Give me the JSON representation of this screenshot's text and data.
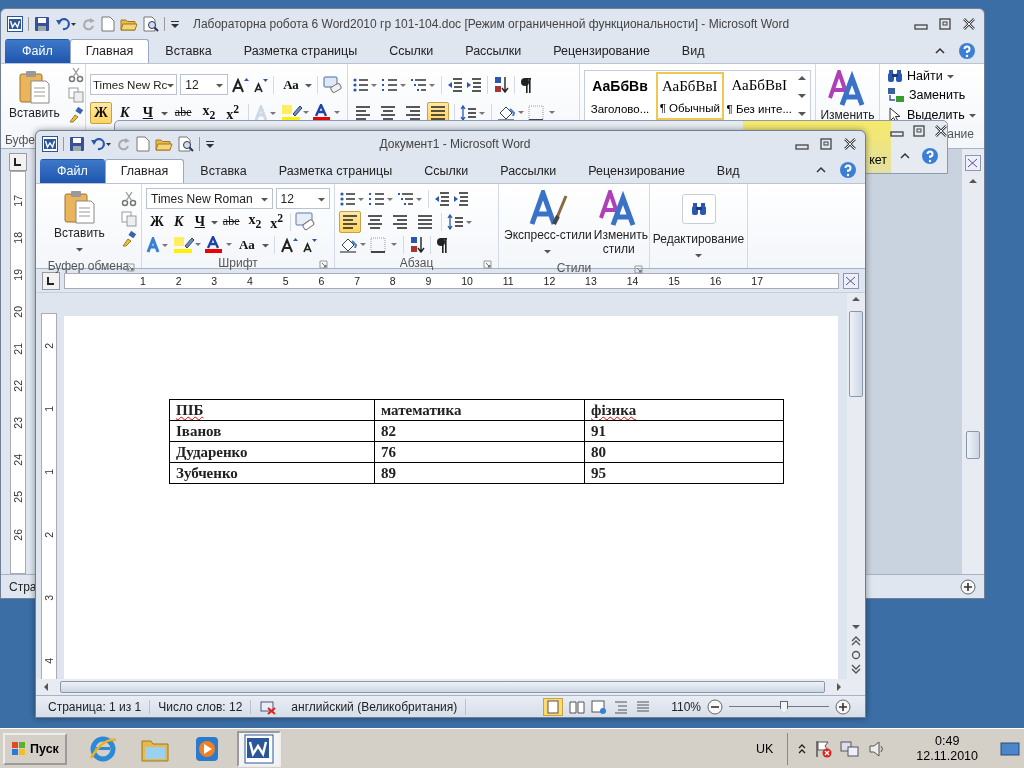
{
  "back_window": {
    "title": "Лабораторна робота 6 Word2010 гр 101-104.doc [Режим ограниченной функциональности]  -  Microsoft Word",
    "tabs": [
      {
        "label": "Файл",
        "kind": "file",
        "selected": false
      },
      {
        "label": "Главная",
        "kind": "tab",
        "selected": true
      },
      {
        "label": "Вставка",
        "kind": "tab",
        "selected": false
      },
      {
        "label": "Разметка страницы",
        "kind": "tab",
        "selected": false
      },
      {
        "label": "Ссылки",
        "kind": "tab",
        "selected": false
      },
      {
        "label": "Рассылки",
        "kind": "tab",
        "selected": false
      },
      {
        "label": "Рецензирование",
        "kind": "tab",
        "selected": false
      },
      {
        "label": "Вид",
        "kind": "tab",
        "selected": false
      }
    ],
    "paste_label": "Вставить",
    "font_name": "Times New Rc",
    "font_size": "12",
    "case_button": "Аа",
    "font_buttons": [
      {
        "label": "Ж",
        "selected": true
      },
      {
        "label": "К",
        "selected": false
      },
      {
        "label": "Ч",
        "selected": false
      },
      {
        "label": "abe",
        "selected": false
      },
      {
        "label": "x$_{2}$",
        "selected": false
      },
      {
        "label": "x$^{2}$",
        "selected": false
      }
    ],
    "align": [
      {
        "selected": false
      },
      {
        "selected": false
      },
      {
        "selected": false
      },
      {
        "selected": true
      }
    ],
    "styles": [
      {
        "sample": "АаБбВв",
        "name": "Заголово...",
        "selected": false
      },
      {
        "sample": "АаБбВвІ",
        "name": "¶ Обычный",
        "selected": true
      },
      {
        "sample": "АаБбВвІ",
        "name": "¶ Без инте...",
        "selected": false
      }
    ],
    "change_styles": "Изменить",
    "editing": [
      {
        "label": "Найти",
        "kind": "find"
      },
      {
        "label": "Заменить",
        "kind": "replace"
      },
      {
        "label": "Выделить",
        "kind": "select"
      }
    ],
    "group_labels": [
      "Буфе",
      "ание"
    ],
    "ruler_numbers": [
      "17",
      "18",
      "19",
      "20",
      "21",
      "22",
      "23",
      "24",
      "25",
      "26"
    ],
    "status": "Стра"
  },
  "third_window": {
    "text": "кет"
  },
  "front_window": {
    "title": "Документ1  -  Microsoft Word",
    "tabs": [
      {
        "label": "Файл",
        "kind": "file",
        "selected": false
      },
      {
        "label": "Главная",
        "kind": "tab",
        "selected": true
      },
      {
        "label": "Вставка",
        "kind": "tab",
        "selected": false
      },
      {
        "label": "Разметка страницы",
        "kind": "tab",
        "selected": false
      },
      {
        "label": "Ссылки",
        "kind": "tab",
        "selected": false
      },
      {
        "label": "Рассылки",
        "kind": "tab",
        "selected": false
      },
      {
        "label": "Рецензирование",
        "kind": "tab",
        "selected": false
      },
      {
        "label": "Вид",
        "kind": "tab",
        "selected": false
      }
    ],
    "paste_label": "Вставить",
    "font_name": "Times New Roman",
    "font_size": "12",
    "case_button": "Аа",
    "font_buttons": [
      {
        "label": "Ж",
        "selected": false
      },
      {
        "label": "К",
        "selected": false
      },
      {
        "label": "Ч",
        "selected": false
      },
      {
        "label": "abe",
        "selected": false
      },
      {
        "label": "x$_{2}$",
        "selected": false
      },
      {
        "label": "x$^{2}$",
        "selected": false
      }
    ],
    "align": [
      {
        "selected": true
      },
      {
        "selected": false
      },
      {
        "selected": false
      },
      {
        "selected": false
      }
    ],
    "quick_styles": "Экспресс-стили",
    "change_styles": "Изменить стили",
    "editing": "Редактирование",
    "group_labels": [
      "Буфер обмена",
      "Шрифт",
      "Абзац",
      "Стили"
    ],
    "ruler_numbers": [
      "1",
      "2",
      "3",
      "4",
      "5",
      "6",
      "7",
      "8",
      "9",
      "10",
      "11",
      "12",
      "13",
      "14",
      "15",
      "16",
      "17"
    ],
    "vruler_numbers": [
      "2",
      "1",
      "1",
      "2",
      "3",
      "4"
    ],
    "table": {
      "columns": [
        {
          "label": "ПІБ",
          "misspelled": true
        },
        {
          "label": "математика",
          "misspelled": false
        },
        {
          "label": "фізика",
          "misspelled": true
        }
      ],
      "rows": [
        [
          "Іванов",
          "82",
          "91"
        ],
        [
          "Дударенко",
          "76",
          "80"
        ],
        [
          "Зубченко",
          "89",
          "95"
        ]
      ]
    },
    "status_bar": {
      "page": "Страница: 1 из 1",
      "words": "Число слов: 12",
      "language": "английский (Великобритания)",
      "zoom": "110%",
      "zoom_slider": {
        "level": 0.55
      }
    }
  },
  "taskbar": {
    "start": "Пуск",
    "apps": [
      {
        "kind": "browser",
        "selected": false
      },
      {
        "kind": "folder",
        "selected": false
      },
      {
        "kind": "media",
        "selected": false
      },
      {
        "kind": "word",
        "selected": true
      }
    ],
    "language": "UK",
    "time": "0:49",
    "date": "12.11.2010"
  }
}
